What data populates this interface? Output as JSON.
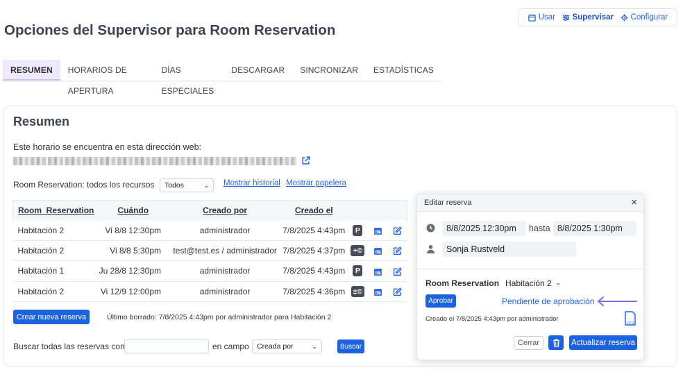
{
  "modes": [
    {
      "label": "Usar",
      "icon": "calendar-icon",
      "active": false
    },
    {
      "label": "Supervisar",
      "icon": "sliders-icon",
      "active": true
    },
    {
      "label": "Configurar",
      "icon": "gear-icon",
      "active": false
    }
  ],
  "page_title": "Opciones del Supervisor para Room Reservation",
  "tabs": [
    "RESUMEN",
    "HORARIOS DE APERTURA",
    "DÍAS ESPECIALES",
    "DESCARGAR",
    "SINCRONIZAR",
    "ESTADÍSTICAS"
  ],
  "summary": {
    "title": "Resumen",
    "url_label": "Este horario se encuentra en esta dirección web:",
    "filter_label": "Room Reservation: todos los recursos",
    "filter_value": "Todos",
    "history_link": "Mostrar historial",
    "trash_link": "Mostrar papelera",
    "columns": [
      "Room_Reservation",
      "Cuándo",
      "Creado por",
      "Creado el"
    ],
    "rows": [
      {
        "room": "Habitación 2",
        "when": "Vi 8/8 12:30pm",
        "by": "administrador",
        "created": "7/8/2025 4:43pm",
        "badge": "P"
      },
      {
        "room": "Habitación 2",
        "when": "Vi 8/8 5:30pm",
        "by": "test@test.es / administrador",
        "created": "7/8/2025 4:37pm",
        "badge": "+©"
      },
      {
        "room": "Habitación 1",
        "when": "Ju 28/8 12:30pm",
        "by": "administrador",
        "created": "7/8/2025 4:43pm",
        "badge": "P"
      },
      {
        "room": "Habitación 2",
        "when": "Vi 12/9 12:00pm",
        "by": "administrador",
        "created": "7/8/2025 4:36pm",
        "badge": "±©"
      }
    ],
    "new_button": "Crear nueva reserva",
    "last_deleted": "Último borrado: 7/8/2025 4:43pm por administrador para Habitación 2",
    "search_label": "Buscar todas las reservas con",
    "search_value": "",
    "field_label": "en campo",
    "field_value": "Creada por",
    "search_button": "Buscar"
  },
  "edit": {
    "title": "Editar reserva",
    "close": "×",
    "start": "8/8/2025 12:30pm",
    "until": "hasta",
    "end": "8/8/2025 1:30pm",
    "person": "Sonja Rustveld",
    "room_label": "Room Reservation",
    "room_value": "Habitación 2",
    "approve_button": "Aprobar",
    "pending": "Pendiente de aprobación",
    "created_info": "Creado el 7/8/2025 4:43pm por administrador",
    "ics_label": "ICS",
    "close_button": "Cerrar",
    "update_button": "Actualizar reserva"
  },
  "colors": {
    "accent": "#1d63e0",
    "link": "#2563eb",
    "tab_active_bg": "#eeeafc",
    "badge_bg": "#474b57",
    "arrow": "#7b6ee6"
  }
}
